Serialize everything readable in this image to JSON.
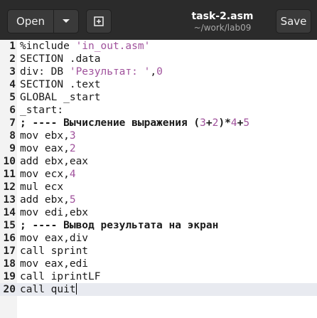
{
  "header": {
    "open_label": "Open",
    "save_label": "Save",
    "title": "task-2.asm",
    "subtitle": "~/work/lab09"
  },
  "editor": {
    "lines": [
      {
        "n": "1",
        "parts": [
          {
            "t": "%include ",
            "c": "kw"
          },
          {
            "t": "'in_out.asm'",
            "c": "str"
          }
        ]
      },
      {
        "n": "2",
        "parts": [
          {
            "t": "SECTION .data",
            "c": "kw"
          }
        ]
      },
      {
        "n": "3",
        "parts": [
          {
            "t": "div: DB ",
            "c": "kw"
          },
          {
            "t": "'Результат: '",
            "c": "str"
          },
          {
            "t": ",",
            "c": "kw"
          },
          {
            "t": "0",
            "c": "num"
          }
        ]
      },
      {
        "n": "4",
        "parts": [
          {
            "t": "SECTION .text",
            "c": "kw"
          }
        ]
      },
      {
        "n": "5",
        "parts": [
          {
            "t": "GLOBAL _start",
            "c": "kw"
          }
        ]
      },
      {
        "n": "6",
        "parts": [
          {
            "t": "_start:",
            "c": "kw"
          }
        ]
      },
      {
        "n": "7",
        "parts": [
          {
            "t": "; ---- Вычисление выражения (",
            "c": "cmt"
          },
          {
            "t": "3",
            "c": "num"
          },
          {
            "t": "+",
            "c": "cmt"
          },
          {
            "t": "2",
            "c": "num"
          },
          {
            "t": ")*",
            "c": "cmt"
          },
          {
            "t": "4",
            "c": "num"
          },
          {
            "t": "+",
            "c": "cmt"
          },
          {
            "t": "5",
            "c": "num"
          }
        ]
      },
      {
        "n": "8",
        "parts": [
          {
            "t": "mov ebx,",
            "c": "kw"
          },
          {
            "t": "3",
            "c": "num"
          }
        ]
      },
      {
        "n": "9",
        "parts": [
          {
            "t": "mov eax,",
            "c": "kw"
          },
          {
            "t": "2",
            "c": "num"
          }
        ]
      },
      {
        "n": "10",
        "parts": [
          {
            "t": "add ebx,eax",
            "c": "kw"
          }
        ]
      },
      {
        "n": "11",
        "parts": [
          {
            "t": "mov ecx,",
            "c": "kw"
          },
          {
            "t": "4",
            "c": "num"
          }
        ]
      },
      {
        "n": "12",
        "parts": [
          {
            "t": "mul ecx",
            "c": "kw"
          }
        ]
      },
      {
        "n": "13",
        "parts": [
          {
            "t": "add ebx,",
            "c": "kw"
          },
          {
            "t": "5",
            "c": "num"
          }
        ]
      },
      {
        "n": "14",
        "parts": [
          {
            "t": "mov edi,ebx",
            "c": "kw"
          }
        ]
      },
      {
        "n": "15",
        "parts": [
          {
            "t": "; ---- Вывод результата на экран",
            "c": "cmt"
          }
        ]
      },
      {
        "n": "16",
        "parts": [
          {
            "t": "mov eax,div",
            "c": "kw"
          }
        ]
      },
      {
        "n": "17",
        "parts": [
          {
            "t": "call sprint",
            "c": "kw"
          }
        ]
      },
      {
        "n": "18",
        "parts": [
          {
            "t": "mov eax,edi",
            "c": "kw"
          }
        ]
      },
      {
        "n": "19",
        "parts": [
          {
            "t": "call iprintLF",
            "c": "kw"
          }
        ]
      },
      {
        "n": "20",
        "parts": [
          {
            "t": "call quit",
            "c": "kw"
          }
        ]
      }
    ],
    "current_line": 20
  }
}
